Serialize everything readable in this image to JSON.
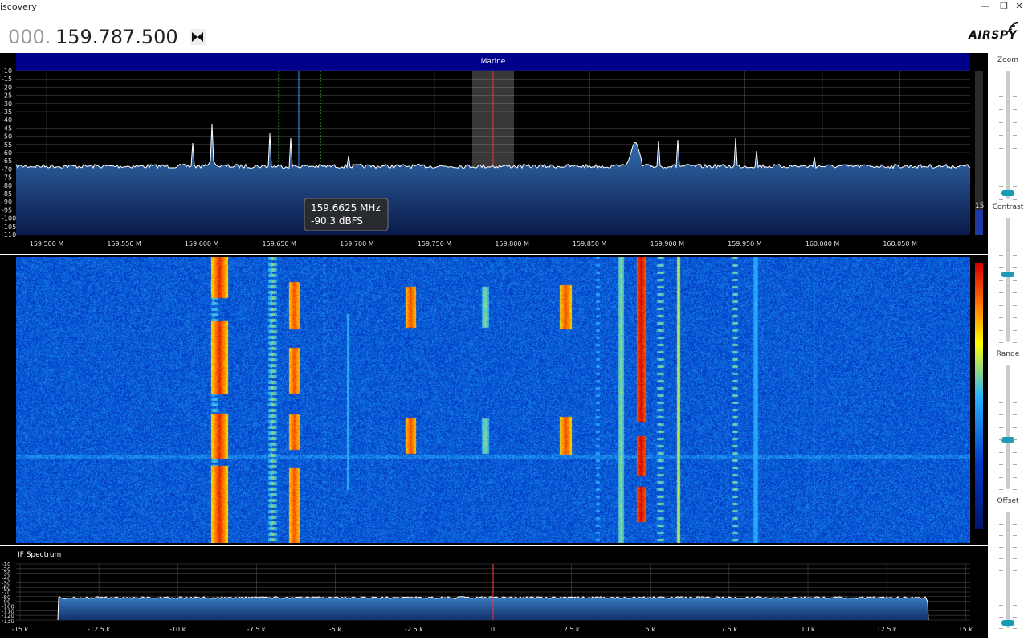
{
  "window": {
    "title": "iscovery",
    "minimize_glyph": "—",
    "restore_glyph": "❐",
    "close_glyph": "✕"
  },
  "frequency": {
    "prefix": "000.",
    "main": "159.787.500",
    "swap_icon": "bowtie-swap-icon"
  },
  "logo": {
    "text": "AIRSPY",
    "icon": "signal-waves-icon"
  },
  "spectrum": {
    "band_label": "Marine",
    "y_ticks": [
      "-10",
      "-15",
      "-20",
      "-25",
      "-30",
      "-35",
      "-40",
      "-45",
      "-50",
      "-55",
      "-60",
      "-65",
      "-70",
      "-75",
      "-80",
      "-85",
      "-90",
      "-95",
      "-100",
      "-105",
      "-110"
    ],
    "x_ticks": [
      "159.500 M",
      "159.550 M",
      "159.600 M",
      "159.650 M",
      "159.700 M",
      "159.750 M",
      "159.800 M",
      "159.850 M",
      "159.900 M",
      "159.950 M",
      "160.000 M",
      "160.050 M"
    ],
    "tooltip_freq": "159.6625 MHz",
    "tooltip_level": "-90.3 dBFS",
    "side_level": "15",
    "band_color": "#00008b",
    "trace_color": "#ffffff",
    "fill_color": "#2a6aa8"
  },
  "if_spectrum": {
    "title": "IF Spectrum",
    "y_ticks": [
      "-10",
      "-20",
      "-30",
      "-40",
      "-50",
      "-60",
      "-70",
      "-80",
      "-90",
      "-100",
      "-110",
      "-120",
      "-130"
    ],
    "x_ticks": [
      "-15 k",
      "-12.5 k",
      "-10 k",
      "-7.5 k",
      "-5 k",
      "-2.5 k",
      "0",
      "2.5 k",
      "5 k",
      "7.5 k",
      "10 k",
      "12.5 k",
      "15 k"
    ]
  },
  "controls": {
    "zoom_label": "Zoom",
    "contrast_label": "Contrast",
    "range_label": "Range",
    "offset_label": "Offset",
    "zoom_level": 0.05,
    "contrast_level": 0.55,
    "range_level": 0.4,
    "offset_level": 0.05,
    "thumb_color": "#1a9bb5"
  }
}
